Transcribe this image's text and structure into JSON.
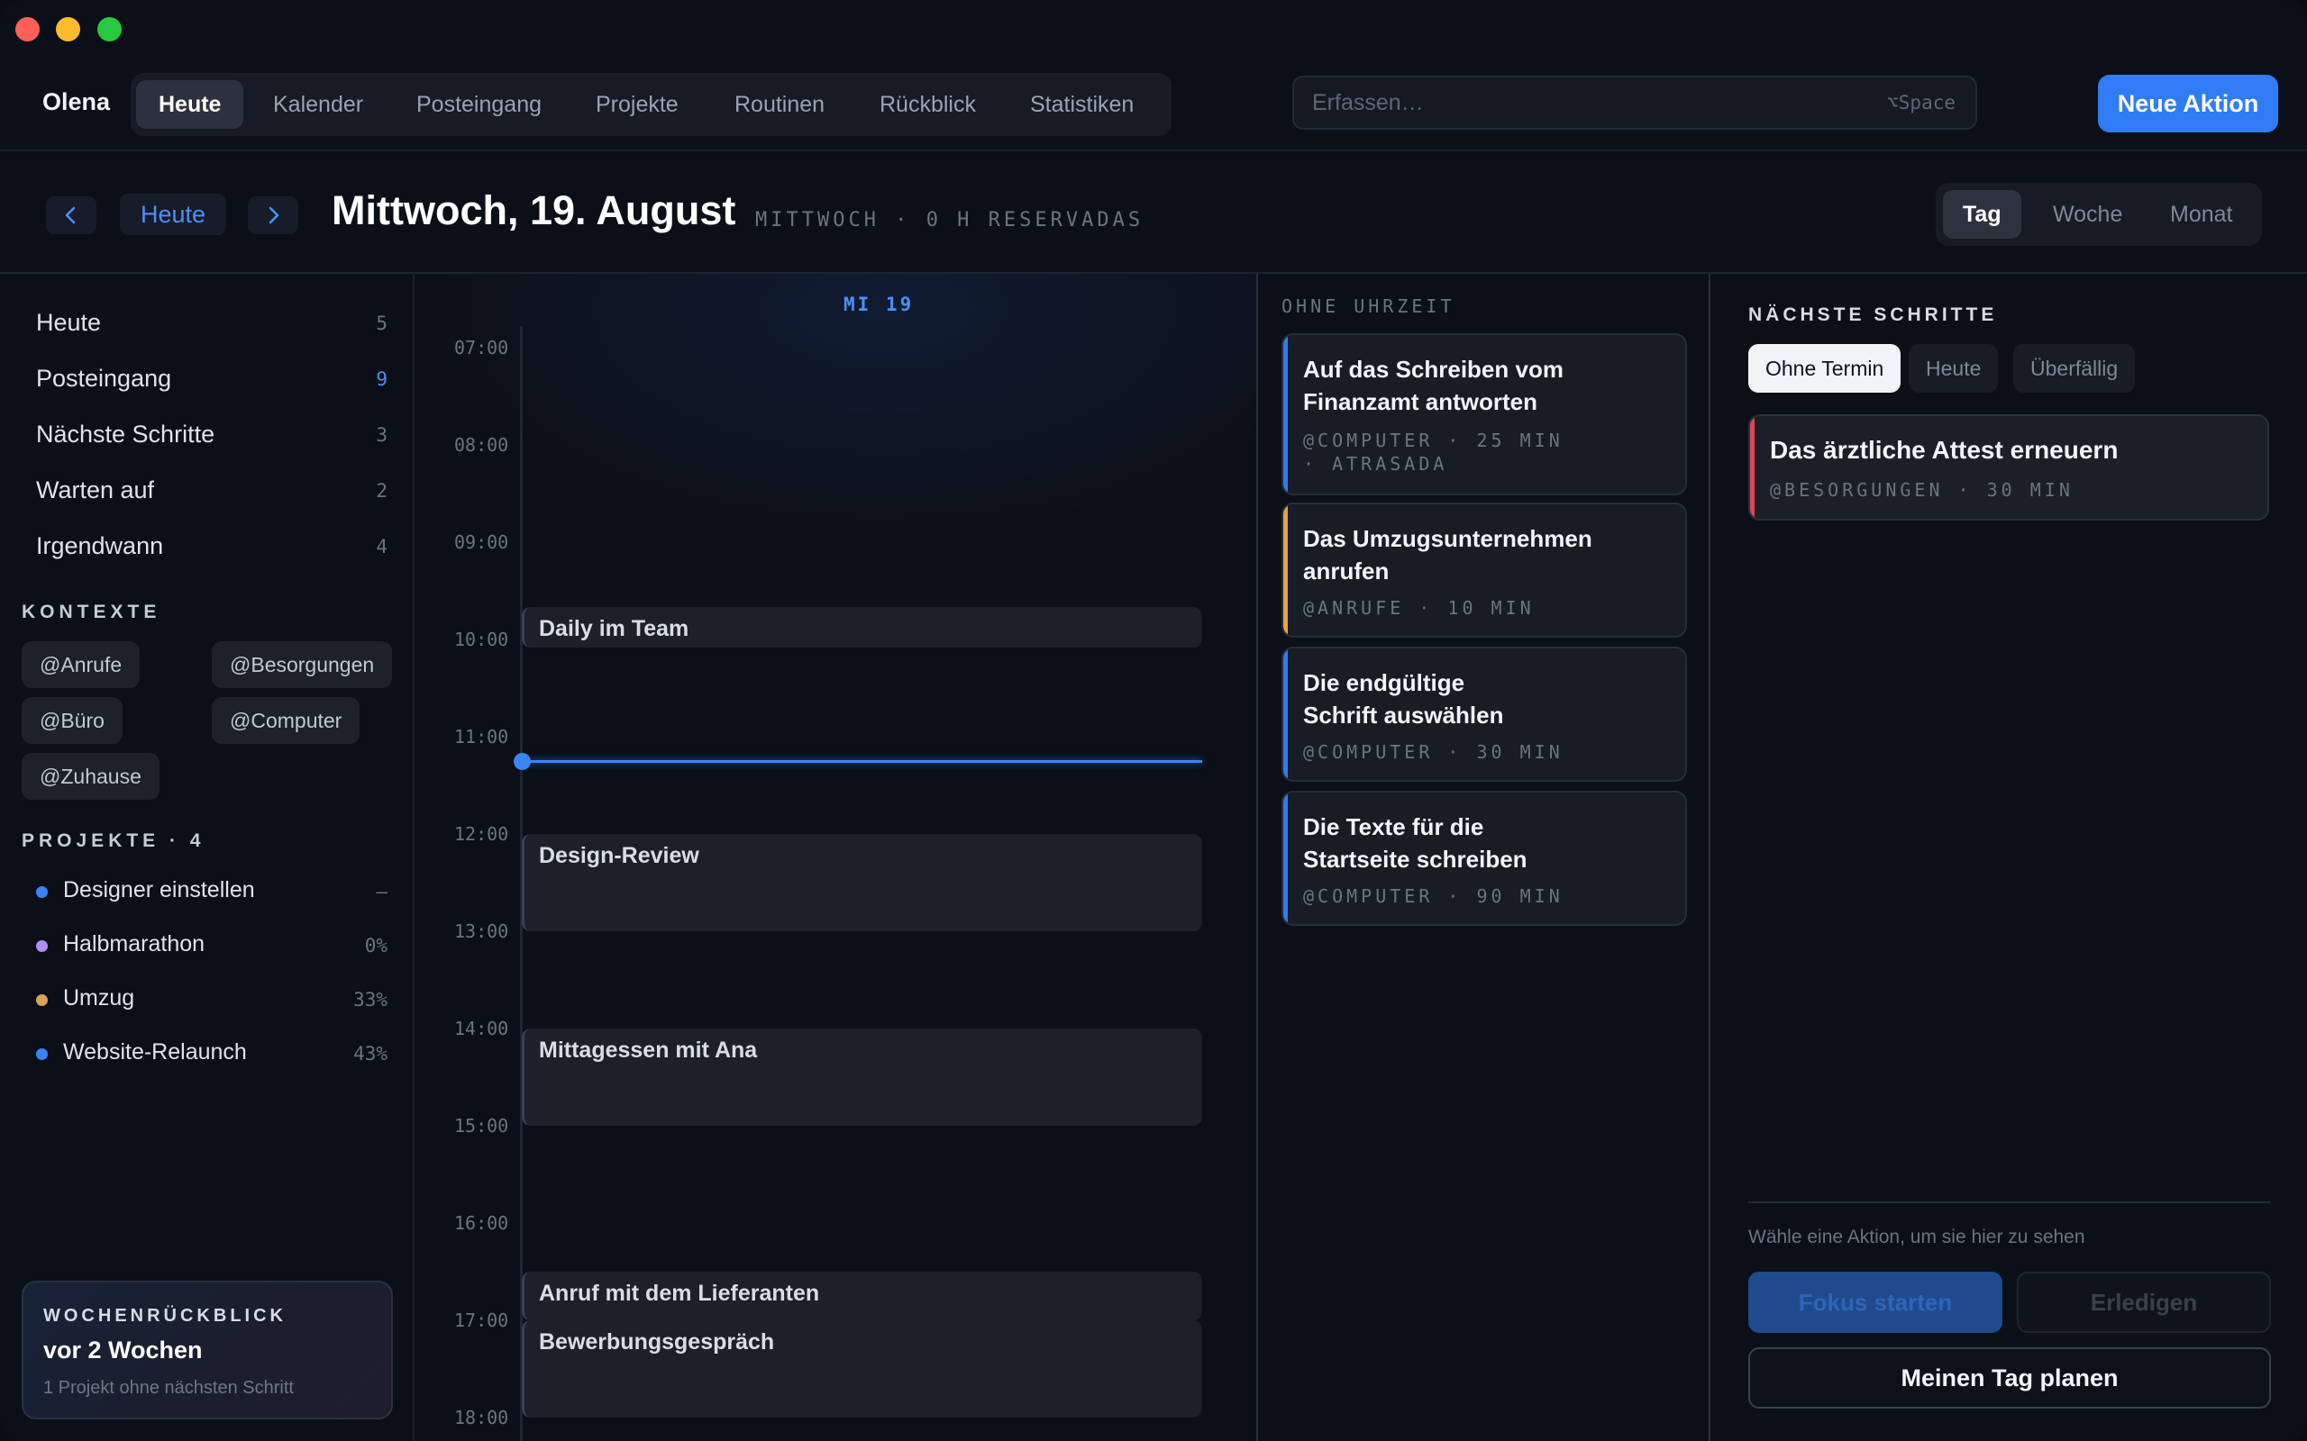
{
  "window": {
    "traffic_colors": [
      "#fe5f57",
      "#febc2e",
      "#28c840"
    ]
  },
  "topbar": {
    "brand": "Olena",
    "tabs": [
      "Heute",
      "Kalender",
      "Posteingang",
      "Projekte",
      "Routinen",
      "Rückblick",
      "Statistiken"
    ],
    "active_tab": "Heute",
    "capture_placeholder": "Erfassen…",
    "capture_shortcut": "⌥Space",
    "new_action_label": "Neue Aktion"
  },
  "dateheader": {
    "today_label": "Heute",
    "date_title": "Mittwoch, 19. August",
    "date_info": "MITTWOCH · 0 H RESERVADAS",
    "views": [
      "Tag",
      "Woche",
      "Monat"
    ],
    "active_view": "Tag"
  },
  "sidebar": {
    "lists": [
      {
        "label": "Heute",
        "count": "5"
      },
      {
        "label": "Posteingang",
        "count": "9"
      },
      {
        "label": "Nächste Schritte",
        "count": "3"
      },
      {
        "label": "Warten auf",
        "count": "2"
      },
      {
        "label": "Irgendwann",
        "count": "4"
      }
    ],
    "contexts_heading": "KONTEXTE",
    "contexts": [
      "@Anrufe",
      "@Besorgungen",
      "@Büro",
      "@Computer",
      "@Zuhause"
    ],
    "projects_heading": "PROJEKTE · 4",
    "projects": [
      {
        "label": "Designer einstellen",
        "progress": "—",
        "color": "#3b82f6"
      },
      {
        "label": "Halbmarathon",
        "progress": "0%",
        "color": "#b08cf7"
      },
      {
        "label": "Umzug",
        "progress": "33%",
        "color": "#d9a45a"
      },
      {
        "label": "Website-Relaunch",
        "progress": "43%",
        "color": "#3b82f6"
      }
    ],
    "review": {
      "heading": "WOCHENRÜCKBLICK",
      "title": "vor 2 Wochen",
      "subtitle": "1 Projekt ohne nächsten Schritt"
    }
  },
  "timeline": {
    "day_label": "MI 19",
    "hours": [
      "07:00",
      "08:00",
      "09:00",
      "10:00",
      "11:00",
      "12:00",
      "13:00",
      "14:00",
      "15:00",
      "16:00",
      "17:00",
      "18:00"
    ],
    "events": [
      {
        "title": "Daily im Team",
        "start": "09:40",
        "end": "10:05"
      },
      {
        "title": "Design-Review",
        "start": "12:00",
        "end": "13:00"
      },
      {
        "title": "Mittagessen mit Ana",
        "start": "14:00",
        "end": "15:00"
      },
      {
        "title": "Anruf mit dem Lieferanten",
        "start": "16:30",
        "end": "17:00"
      },
      {
        "title": "Bewerbungsgespräch",
        "start": "17:00",
        "end": "18:00"
      }
    ],
    "now": "11:15"
  },
  "unscheduled": {
    "heading": "OHNE UHRZEIT",
    "cards": [
      {
        "title": "Auf das Schreiben vom Finanzamt antworten",
        "meta": "@COMPUTER · 25 MIN",
        "meta2": "· ATRASADA",
        "color": "#2f7cf6"
      },
      {
        "title": "Das Umzugsunternehmen anrufen",
        "meta": "@ANRUFE · 10 MIN",
        "meta2": "",
        "color": "#e8a43a"
      },
      {
        "title": "Die endgültige Schrift auswählen",
        "meta": "@COMPUTER · 30 MIN",
        "meta2": "",
        "color": "#2f7cf6"
      },
      {
        "title": "Die Texte für die Startseite schreiben",
        "meta": "@COMPUTER · 90 MIN",
        "meta2": "",
        "color": "#2f7cf6"
      }
    ]
  },
  "rightpanel": {
    "heading": "NÄCHSTE SCHRITTE",
    "filters": [
      "Ohne Termin",
      "Heute",
      "Überfällig"
    ],
    "active_filter": "Ohne Termin",
    "card": {
      "title": "Das ärztliche Attest erneuern",
      "meta": "@BESORGUNGEN · 30 MIN"
    },
    "hint": "Wähle eine Aktion, um sie hier zu sehen",
    "focus_label": "Fokus starten",
    "done_label": "Erledigen",
    "plan_label": "Meinen Tag planen"
  }
}
